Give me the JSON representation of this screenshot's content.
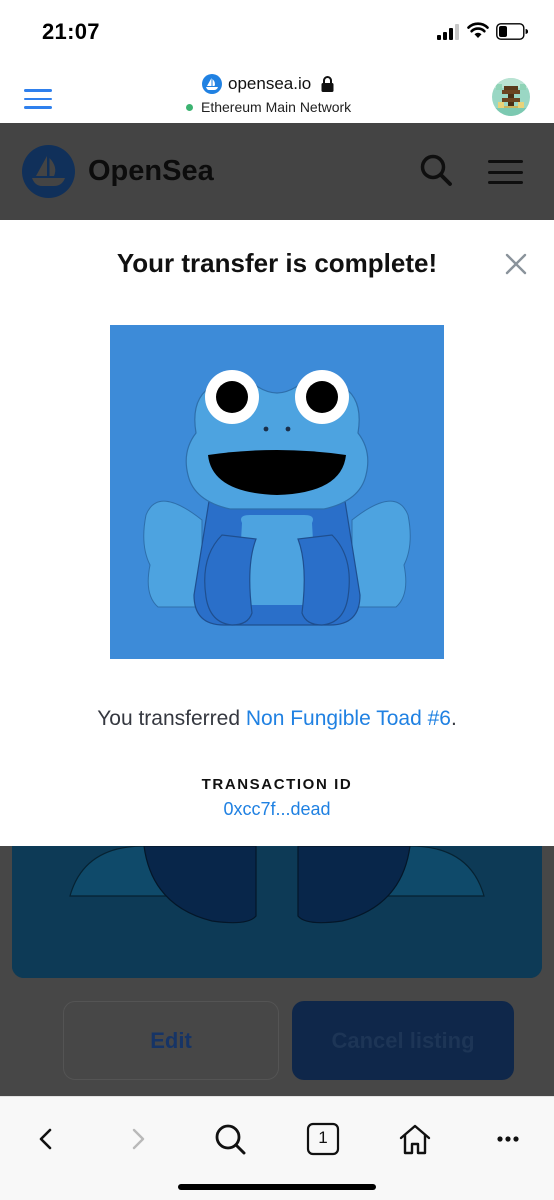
{
  "status_bar": {
    "time": "21:07"
  },
  "browser": {
    "domain": "opensea.io",
    "network": "Ethereum Main Network",
    "accent_color": "#2f80ed",
    "network_color": "#3cb371"
  },
  "site": {
    "brand": "OpenSea"
  },
  "modal": {
    "title": "Your transfer is complete!",
    "message_prefix": "You transferred ",
    "nft_name": "Non Fungible Toad #6",
    "message_suffix": ".",
    "transaction_label": "TRANSACTION ID",
    "transaction_id": "0xcc7f...dead",
    "link_color": "#2081e2"
  },
  "actions": {
    "edit_label": "Edit",
    "cancel_listing_label": "Cancel listing"
  },
  "toolbar": {
    "tab_count": "1",
    "icons": [
      "back-icon",
      "forward-icon",
      "search-icon",
      "tabs-icon",
      "home-icon",
      "more-icon"
    ]
  }
}
